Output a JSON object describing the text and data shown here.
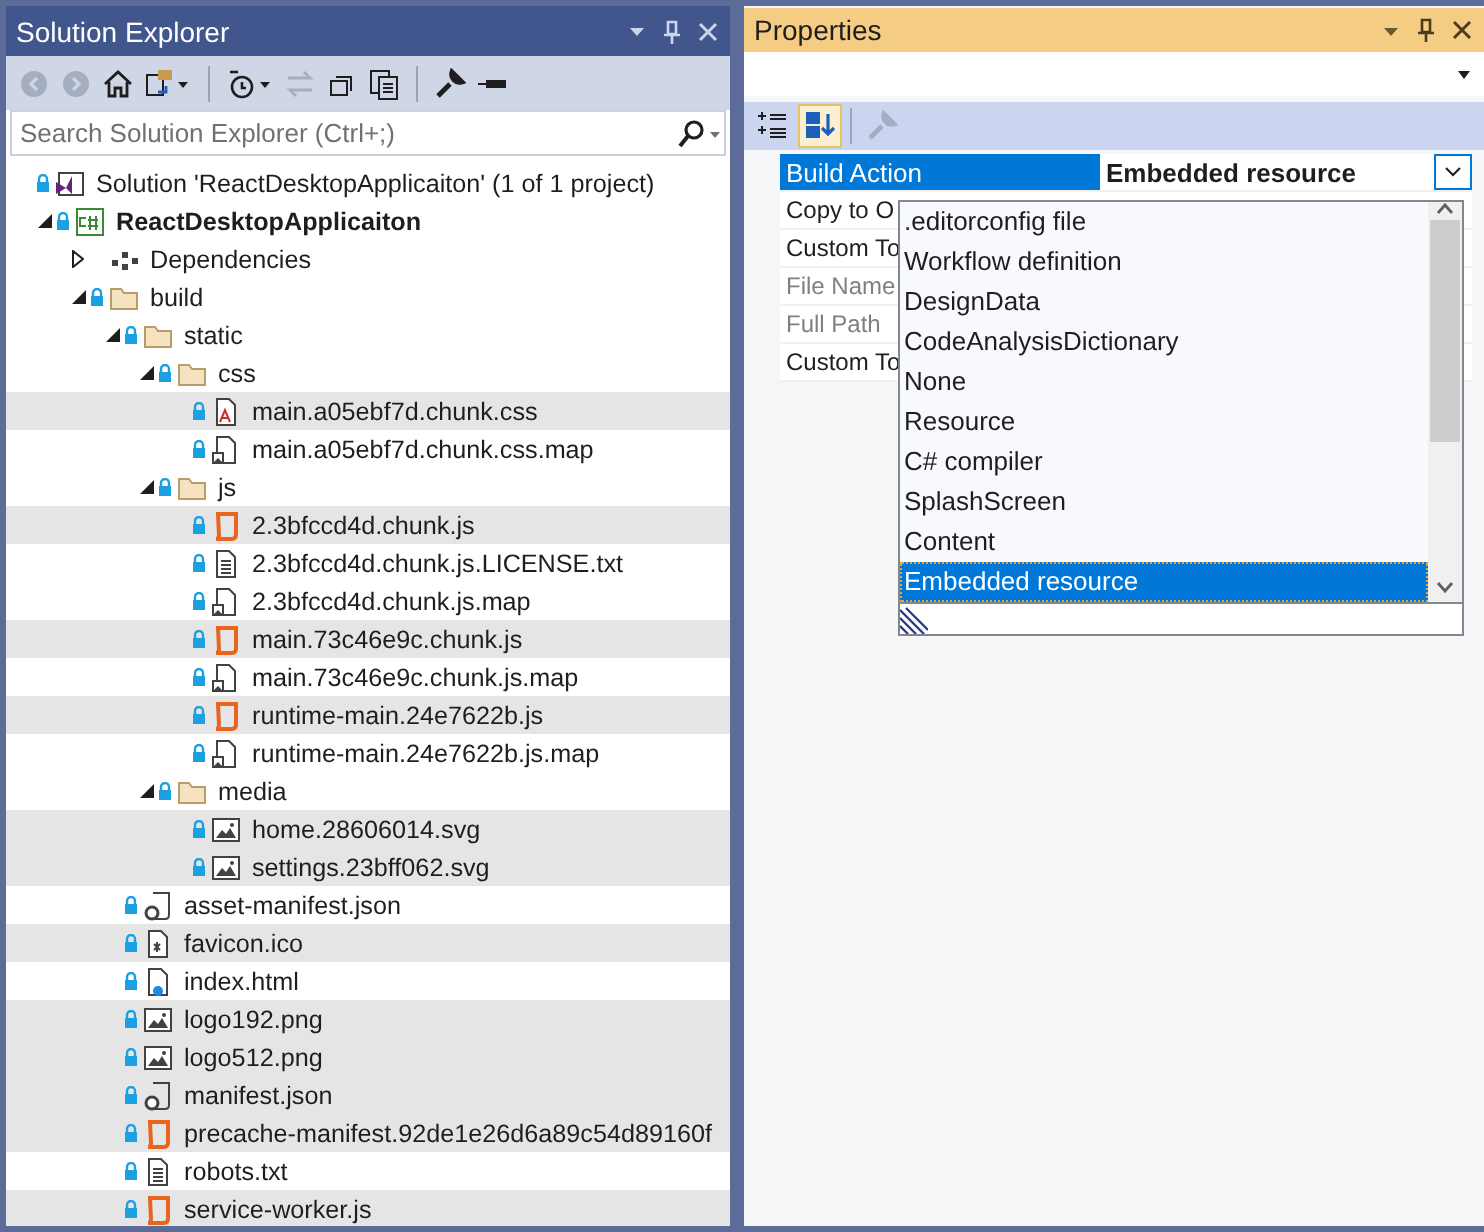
{
  "solution_explorer": {
    "title": "Solution Explorer",
    "search": {
      "placeholder": "Search Solution Explorer (Ctrl+;)"
    },
    "solution": {
      "label": "Solution 'ReactDesktopApplicaiton' (1 of 1 project)",
      "locked": true,
      "selected": false
    },
    "tree": [
      {
        "label": "ReactDesktopApplicaiton",
        "kind": "project",
        "locked": true,
        "expanded": true,
        "selected": false,
        "children": [
          {
            "label": "Dependencies",
            "kind": "dependencies",
            "locked": false,
            "expanded": false,
            "selected": false
          },
          {
            "label": "build",
            "kind": "folder",
            "locked": true,
            "expanded": true,
            "selected": false,
            "children": [
              {
                "label": "static",
                "kind": "folder",
                "locked": true,
                "expanded": true,
                "selected": false,
                "children": [
                  {
                    "label": "css",
                    "kind": "folder",
                    "locked": true,
                    "expanded": true,
                    "selected": false,
                    "children": [
                      {
                        "label": "main.a05ebf7d.chunk.css",
                        "kind": "css",
                        "locked": true,
                        "selected": true
                      },
                      {
                        "label": "main.a05ebf7d.chunk.css.map",
                        "kind": "map",
                        "locked": true,
                        "selected": false
                      }
                    ]
                  },
                  {
                    "label": "js",
                    "kind": "folder",
                    "locked": true,
                    "expanded": true,
                    "selected": false,
                    "children": [
                      {
                        "label": "2.3bfccd4d.chunk.js",
                        "kind": "js",
                        "locked": true,
                        "selected": true
                      },
                      {
                        "label": "2.3bfccd4d.chunk.js.LICENSE.txt",
                        "kind": "text",
                        "locked": true,
                        "selected": false
                      },
                      {
                        "label": "2.3bfccd4d.chunk.js.map",
                        "kind": "map",
                        "locked": true,
                        "selected": false
                      },
                      {
                        "label": "main.73c46e9c.chunk.js",
                        "kind": "js",
                        "locked": true,
                        "selected": true
                      },
                      {
                        "label": "main.73c46e9c.chunk.js.map",
                        "kind": "map",
                        "locked": true,
                        "selected": false
                      },
                      {
                        "label": "runtime-main.24e7622b.js",
                        "kind": "js",
                        "locked": true,
                        "selected": true
                      },
                      {
                        "label": "runtime-main.24e7622b.js.map",
                        "kind": "map",
                        "locked": true,
                        "selected": false
                      }
                    ]
                  },
                  {
                    "label": "media",
                    "kind": "folder",
                    "locked": true,
                    "expanded": true,
                    "selected": false,
                    "children": [
                      {
                        "label": "home.28606014.svg",
                        "kind": "image",
                        "locked": true,
                        "selected": true
                      },
                      {
                        "label": "settings.23bff062.svg",
                        "kind": "image",
                        "locked": true,
                        "selected": true
                      }
                    ]
                  }
                ]
              },
              {
                "label": "asset-manifest.json",
                "kind": "json",
                "locked": true,
                "selected": false
              },
              {
                "label": "favicon.ico",
                "kind": "ico",
                "locked": true,
                "selected": true
              },
              {
                "label": "index.html",
                "kind": "html",
                "locked": true,
                "selected": false
              },
              {
                "label": "logo192.png",
                "kind": "image",
                "locked": true,
                "selected": true
              },
              {
                "label": "logo512.png",
                "kind": "image",
                "locked": true,
                "selected": true
              },
              {
                "label": "manifest.json",
                "kind": "json",
                "locked": true,
                "selected": true
              },
              {
                "label": "precache-manifest.92de1e26d6a89c54d89160f",
                "kind": "js",
                "locked": true,
                "selected": true
              },
              {
                "label": "robots.txt",
                "kind": "text",
                "locked": true,
                "selected": false
              },
              {
                "label": "service-worker.js",
                "kind": "js",
                "locked": true,
                "selected": true
              }
            ]
          }
        ]
      }
    ]
  },
  "properties": {
    "title": "Properties",
    "sort_buttons": [
      {
        "kind": "categorized",
        "selected": false
      },
      {
        "kind": "alphabetical",
        "selected": true
      }
    ],
    "property_pages_button": {
      "disabled": true
    },
    "grid": [
      {
        "name": "Build Action",
        "value": "Embedded resource",
        "selected": true,
        "disabled": false
      },
      {
        "name": "Copy to O",
        "selected": false,
        "disabled": false
      },
      {
        "name": "Custom To",
        "selected": false,
        "disabled": false
      },
      {
        "name": "File Name",
        "selected": false,
        "disabled": true
      },
      {
        "name": "Full Path",
        "selected": false,
        "disabled": true
      },
      {
        "name": "Custom To",
        "selected": false,
        "disabled": false
      }
    ],
    "dropdown": {
      "options": [
        {
          "label": ".editorconfig file",
          "selected": false
        },
        {
          "label": "Workflow definition",
          "selected": false
        },
        {
          "label": "DesignData",
          "selected": false
        },
        {
          "label": "CodeAnalysisDictionary",
          "selected": false
        },
        {
          "label": "None",
          "selected": false
        },
        {
          "label": "Resource",
          "selected": false
        },
        {
          "label": "C# compiler",
          "selected": false
        },
        {
          "label": "SplashScreen",
          "selected": false
        },
        {
          "label": "Content",
          "selected": false
        },
        {
          "label": "Embedded resource",
          "selected": true
        }
      ]
    }
  }
}
